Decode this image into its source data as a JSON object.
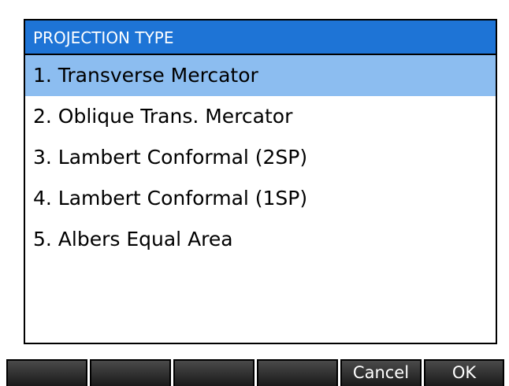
{
  "dialog": {
    "title": "PROJECTION TYPE",
    "selected_index": 0,
    "items": [
      "1. Transverse Mercator",
      "2. Oblique Trans. Mercator",
      "3. Lambert Conformal (2SP)",
      "4. Lambert Conformal (1SP)",
      "5. Albers Equal Area"
    ]
  },
  "softkeys": {
    "key1": "",
    "key2": "",
    "key3": "",
    "key4": "",
    "cancel": "Cancel",
    "ok": "OK"
  },
  "colors": {
    "title_bg": "#1e74d6",
    "selected_bg": "#8cbdf0"
  }
}
